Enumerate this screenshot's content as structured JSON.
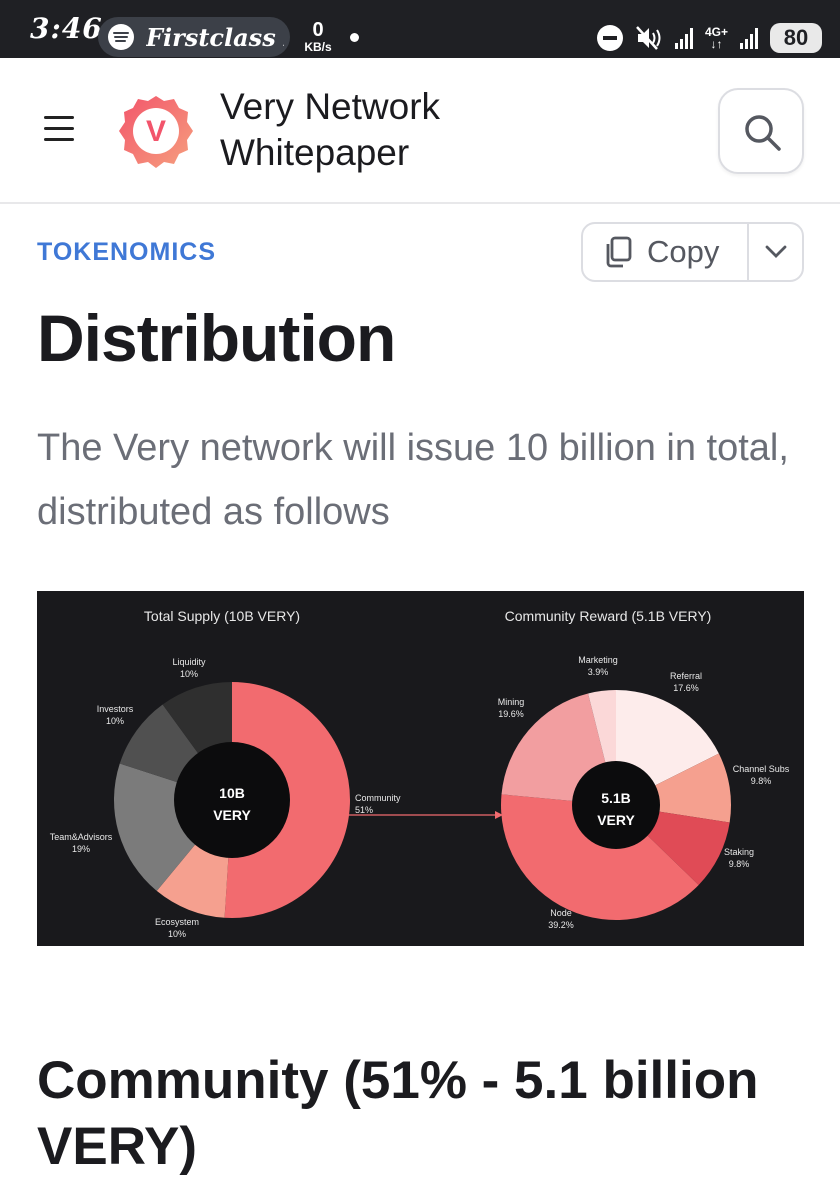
{
  "status_bar": {
    "time": "3:46",
    "media_app_text": "Firstclass M",
    "net_speed_value": "0",
    "net_speed_unit": "KB/s",
    "network_type_top": "4G+",
    "network_type_bottom": "↓↑",
    "battery": "80"
  },
  "header": {
    "logo_letter": "V",
    "title": "Very Network Whitepaper"
  },
  "content": {
    "section_label": "TOKENOMICS",
    "copy_label": "Copy",
    "page_title": "Distribution",
    "intro": "The Very network will issue 10 billion in total, distributed as follows",
    "section_heading": "Community (51% - 5.1 billion VERY)"
  },
  "colors": {
    "accent_link": "#3f78d6",
    "status_bar_bg": "#1f2024",
    "figure_bg": "#19191c"
  },
  "chart_data": [
    {
      "type": "pie",
      "title": "Total Supply (10B VERY)",
      "center_line1": "10B",
      "center_line2": "VERY",
      "slices": [
        {
          "label": "Community",
          "pct_label": "51%",
          "value": 51,
          "color": "#f26b6f"
        },
        {
          "label": "Ecosystem",
          "pct_label": "10%",
          "value": 10,
          "color": "#f5a08f"
        },
        {
          "label": "Team&Advisors",
          "pct_label": "19%",
          "value": 19,
          "color": "#7b7b7b"
        },
        {
          "label": "Investors",
          "pct_label": "10%",
          "value": 10,
          "color": "#505050"
        },
        {
          "label": "Liquidity",
          "pct_label": "10%",
          "value": 10,
          "color": "#2f2f2f"
        }
      ]
    },
    {
      "type": "pie",
      "title": "Community Reward (5.1B VERY)",
      "center_line1": "5.1B",
      "center_line2": "VERY",
      "slices": [
        {
          "label": "Referral",
          "pct_label": "17.6%",
          "value": 17.6,
          "color": "#fdeceb"
        },
        {
          "label": "Channel Subs",
          "pct_label": "9.8%",
          "value": 9.8,
          "color": "#f5a08f"
        },
        {
          "label": "Staking",
          "pct_label": "9.8%",
          "value": 9.8,
          "color": "#e04b56"
        },
        {
          "label": "Node",
          "pct_label": "39.2%",
          "value": 39.2,
          "color": "#f26b6f"
        },
        {
          "label": "Mining",
          "pct_label": "19.6%",
          "value": 19.6,
          "color": "#f29ea0"
        },
        {
          "label": "Marketing",
          "pct_label": "3.9%",
          "value": 3.9,
          "color": "#fbd8d8"
        }
      ]
    }
  ]
}
